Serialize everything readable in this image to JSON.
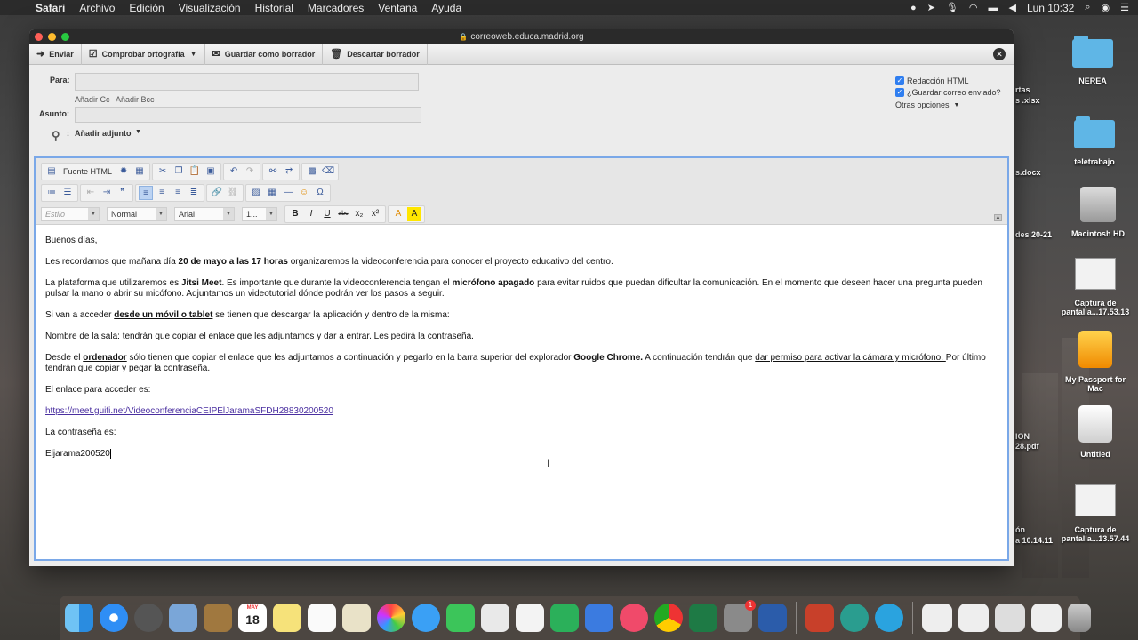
{
  "menubar": {
    "app_name": "Safari",
    "items": [
      "Archivo",
      "Edición",
      "Visualización",
      "Historial",
      "Marcadores",
      "Ventana",
      "Ayuda"
    ],
    "clock": "Lun 10:32"
  },
  "window": {
    "url": "correoweb.educa.madrid.org"
  },
  "mail_toolbar": {
    "send": "Enviar",
    "spellcheck": "Comprobar ortografía",
    "save_draft": "Guardar como borrador",
    "discard_draft": "Descartar borrador"
  },
  "headers": {
    "to_label": "Para:",
    "add_cc": "Añadir Cc",
    "add_bcc": "Añadir Bcc",
    "subject_label": "Asunto:",
    "attach_label": "Añadir adjunto",
    "html_option": "Redacción HTML",
    "save_sent_option": "¿Guardar correo enviado?",
    "more_options": "Otras opciones"
  },
  "editor": {
    "source_html": "Fuente HTML",
    "style_combo": "Estilo",
    "format_combo": "Normal",
    "font_combo": "Arial",
    "size_combo": "1..."
  },
  "message": {
    "greeting": "Buenos días,",
    "p1_a": "Les recordamos que mañana día ",
    "p1_b": "20 de mayo a las 17 horas",
    "p1_c": " organizaremos la videoconferencia para conocer el proyecto educativo del centro.",
    "p2_a": "La plataforma que utilizaremos es ",
    "p2_b": "Jitsi Meet",
    "p2_c": ". Es importante que durante la videoconferencia tengan el ",
    "p2_d": "micrófono apagado",
    "p2_e": " para evitar ruidos que puedan dificultar la comunicación. En el momento que deseen hacer una pregunta pueden pulsar la mano o abrir su micófono. Adjuntamos un videotutorial dónde podrán ver los pasos a seguir.",
    "p3_a": "Si van a acceder ",
    "p3_b": "desde un móvil o tablet",
    "p3_c": " se tienen que descargar la aplicación y dentro de la misma:",
    "p4": "Nombre de la sala: tendrán que copiar el enlace que les adjuntamos y dar a entrar. Les pedirá la contraseña.",
    "p5_a": "Desde el ",
    "p5_b": "ordenador",
    "p5_c": " sólo tienen que copiar el enlace que les adjuntamos a continuación y pegarlo en la barra superior del explorador ",
    "p5_d": "Google Chrome.",
    "p5_e": " A continuación tendrán que ",
    "p5_f": "dar permiso para activar la cámara y micrófono. ",
    "p5_g": "Por último tendrán que copiar y pegar la contraseña.",
    "p6": "El enlace para acceder es:",
    "link": "https://meet.guifi.net/VideoconferenciaCEIPElJaramaSFDH28830200520",
    "p7": "La contraseña es:",
    "password": "Eljarama200520"
  },
  "desktop": {
    "icons": [
      "NEREA",
      "teletrabajo",
      "Macintosh HD",
      "Captura de pantalla...17.53.13",
      "My Passport for Mac",
      "Untitled",
      "Captura de pantalla...13.57.44"
    ],
    "partials": [
      "rtas",
      "s .xlsx",
      "s.docx",
      "des 20-21",
      "ION",
      "28.pdf",
      "ón",
      "a 10.14.11"
    ]
  },
  "dock": {
    "calendar_month": "MAY",
    "calendar_day": "18",
    "badge_count": "1"
  },
  "colors": {
    "accent": "#2f7ef0",
    "editor_border": "#7aa8e8",
    "link": "#4a2fa0"
  }
}
